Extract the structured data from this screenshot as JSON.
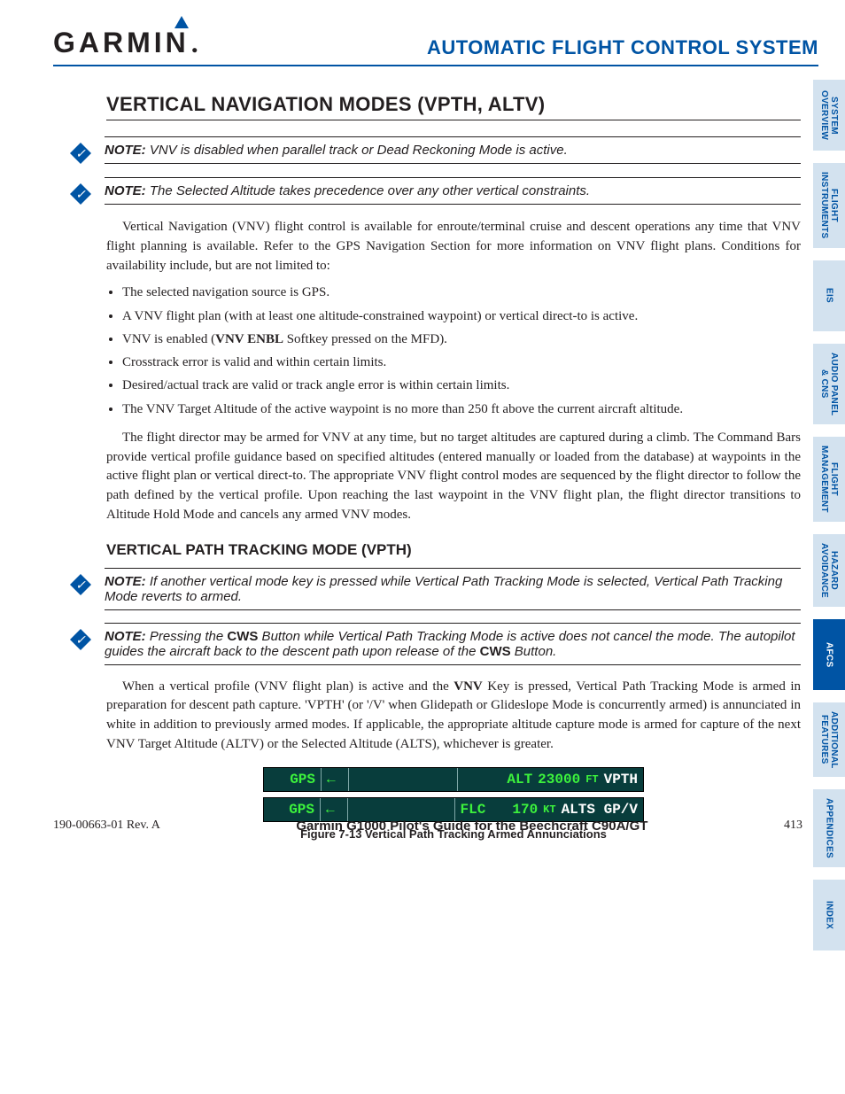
{
  "header": {
    "brand": "GARMIN",
    "title": "AUTOMATIC FLIGHT CONTROL SYSTEM"
  },
  "tabs": [
    {
      "label": "SYSTEM\nOVERVIEW",
      "active": false
    },
    {
      "label": "FLIGHT\nINSTRUMENTS",
      "active": false
    },
    {
      "label": "EIS",
      "active": false
    },
    {
      "label": "AUDIO PANEL\n& CNS",
      "active": false
    },
    {
      "label": "FLIGHT\nMANAGEMENT",
      "active": false
    },
    {
      "label": "HAZARD\nAVOIDANCE",
      "active": false
    },
    {
      "label": "AFCS",
      "active": true
    },
    {
      "label": "ADDITIONAL\nFEATURES",
      "active": false
    },
    {
      "label": "APPENDICES",
      "active": false
    },
    {
      "label": "INDEX",
      "active": false
    }
  ],
  "section_heading": "VERTICAL NAVIGATION MODES (VPTH, ALTV)",
  "notes": {
    "n1": {
      "label": "NOTE:",
      "text": " VNV is disabled when parallel track or Dead Reckoning Mode is active."
    },
    "n2": {
      "label": "NOTE:",
      "text": " The Selected Altitude takes precedence over any other vertical constraints."
    },
    "n3": {
      "label": "NOTE:",
      "text": " If another vertical mode key is pressed while Vertical Path Tracking Mode is selected, Vertical Path Tracking Mode reverts to armed."
    },
    "n4_pre": "NOTE:",
    "n4_a": " Pressing the ",
    "n4_b": "CWS",
    "n4_c": " Button while Vertical Path Tracking Mode is active does not cancel the mode.  The autopilot guides the aircraft back to the descent path upon release of the ",
    "n4_d": "CWS",
    "n4_e": " Button."
  },
  "para1": "Vertical Navigation (VNV) flight control is available for enroute/terminal cruise and descent operations any time that VNV flight planning is available.  Refer to the GPS Navigation Section for more information on VNV flight plans.  Conditions for availability include, but are not limited to:",
  "bullets": {
    "b1": "The selected navigation source is GPS.",
    "b2": "A VNV flight plan (with at least one altitude-constrained waypoint) or vertical direct-to is active.",
    "b3a": "VNV is enabled (",
    "b3b": "VNV ENBL",
    "b3c": " Softkey pressed on the MFD).",
    "b4": "Crosstrack error is valid and within certain limits.",
    "b5": "Desired/actual track are valid or track angle error is within certain limits.",
    "b6": "The VNV Target Altitude of the active waypoint is no more than 250 ft above the current aircraft altitude."
  },
  "para2": "The flight director may be armed for VNV at any time, but no target altitudes are captured during a climb.  The Command Bars provide vertical profile guidance based on specified altitudes (entered manually or loaded from the database) at waypoints in the active flight plan or vertical direct-to.  The appropriate VNV flight control modes are sequenced by the flight director to follow the path defined by the vertical profile.  Upon reaching the last waypoint in the VNV flight plan, the flight director transitions to Altitude Hold Mode and cancels any armed VNV modes.",
  "sub_heading": "VERTICAL PATH TRACKING MODE (VPTH)",
  "para3a": "When a vertical profile (VNV flight plan) is active and the ",
  "para3b": "VNV",
  "para3c": " Key is pressed, Vertical Path Tracking Mode is armed in preparation for descent path capture.  'VPTH' (or '/V' when Glidepath or Glideslope Mode is concurrently armed) is annunciated in white in addition to previously armed modes.  If applicable, the appropriate altitude capture mode is armed for capture of the next VNV Target Altitude (ALTV) or the Selected Altitude (ALTS), whichever is greater.",
  "annunciators": {
    "row1": {
      "gps": "GPS",
      "arrow": "←",
      "mode": "ALT",
      "val": "23000",
      "unit": "FT",
      "armed": "VPTH"
    },
    "row2": {
      "gps": "GPS",
      "arrow": "←",
      "mode": "FLC",
      "val": "170",
      "unit": "KT",
      "armed": "ALTS GP/V"
    }
  },
  "figure_caption": "Figure 7-13  Vertical Path Tracking Armed Annunciations",
  "footer": {
    "left": "190-00663-01  Rev. A",
    "center": "Garmin G1000 Pilot's Guide for the Beechcraft C90A/GT",
    "right": "413"
  }
}
